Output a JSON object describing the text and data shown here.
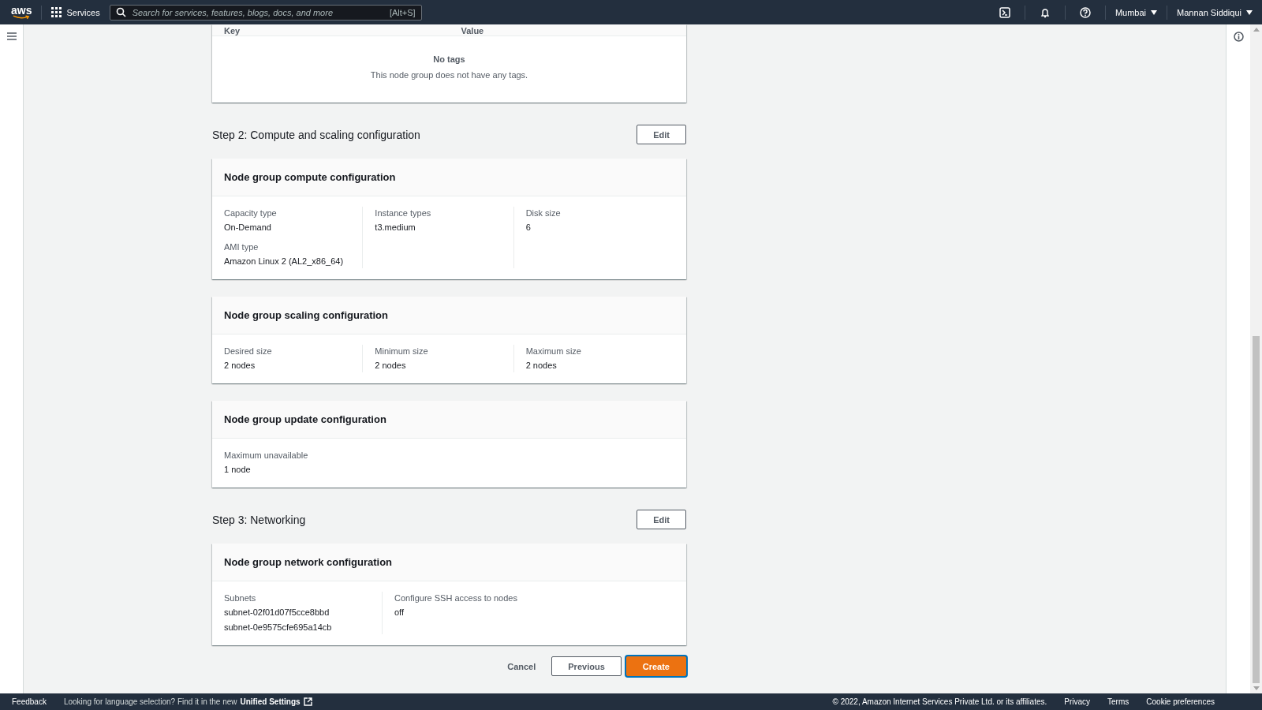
{
  "top_nav": {
    "logo": "aws",
    "services": "Services",
    "search": {
      "placeholder": "Search for services, features, blogs, docs, and more",
      "shortcut": "[Alt+S]"
    },
    "region": "Mumbai",
    "user": "Mannan Siddiqui"
  },
  "tags_table": {
    "columns": [
      "Key",
      "Value"
    ],
    "empty_title": "No tags",
    "empty_text": "This node group does not have any tags."
  },
  "steps": [
    {
      "title": "Step 2: Compute and scaling configuration",
      "edit": "Edit",
      "cards": [
        {
          "title": "Node group compute configuration",
          "columns": [
            [
              {
                "label": "Capacity type",
                "values": [
                  "On-Demand"
                ]
              },
              {
                "label": "AMI type",
                "values": [
                  "Amazon Linux 2 (AL2_x86_64)"
                ]
              }
            ],
            [
              {
                "label": "Instance types",
                "values": [
                  "t3.medium"
                ]
              }
            ],
            [
              {
                "label": "Disk size",
                "values": [
                  "6"
                ]
              }
            ]
          ]
        },
        {
          "title": "Node group scaling configuration",
          "columns": [
            [
              {
                "label": "Desired size",
                "values": [
                  "2 nodes"
                ]
              }
            ],
            [
              {
                "label": "Minimum size",
                "values": [
                  "2 nodes"
                ]
              }
            ],
            [
              {
                "label": "Maximum size",
                "values": [
                  "2 nodes"
                ]
              }
            ]
          ]
        },
        {
          "title": "Node group update configuration",
          "columns": [
            [
              {
                "label": "Maximum unavailable",
                "values": [
                  "1 node"
                ]
              }
            ]
          ]
        }
      ]
    },
    {
      "title": "Step 3: Networking",
      "edit": "Edit",
      "cards": [
        {
          "title": "Node group network configuration",
          "columns": [
            [
              {
                "label": "Subnets",
                "values": [
                  "subnet-02f01d07f5cce8bbd",
                  "subnet-0e9575cfe695a14cb"
                ]
              }
            ],
            [
              {
                "label": "Configure SSH access to nodes",
                "values": [
                  "off"
                ]
              }
            ]
          ]
        }
      ]
    }
  ],
  "actions": {
    "cancel": "Cancel",
    "previous": "Previous",
    "create": "Create"
  },
  "footer": {
    "feedback": "Feedback",
    "language_note": "Looking for language selection? Find it in the new",
    "settings_link": "Unified Settings",
    "copyright": "© 2022, Amazon Internet Services Private Ltd. or its affiliates.",
    "links": [
      "Privacy",
      "Terms",
      "Cookie preferences"
    ]
  }
}
